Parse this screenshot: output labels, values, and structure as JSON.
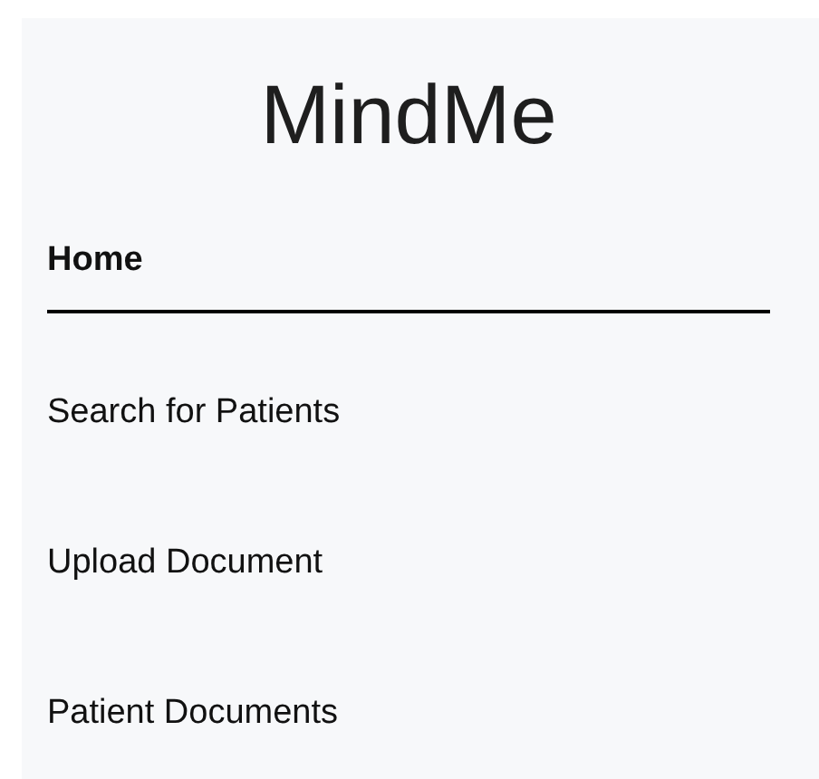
{
  "sidebar": {
    "title": "MindMe",
    "items": [
      {
        "label": "Home",
        "selected": true
      },
      {
        "label": "Search for Patients",
        "selected": false
      },
      {
        "label": "Upload Document",
        "selected": false
      },
      {
        "label": "Patient Documents",
        "selected": false
      }
    ]
  }
}
